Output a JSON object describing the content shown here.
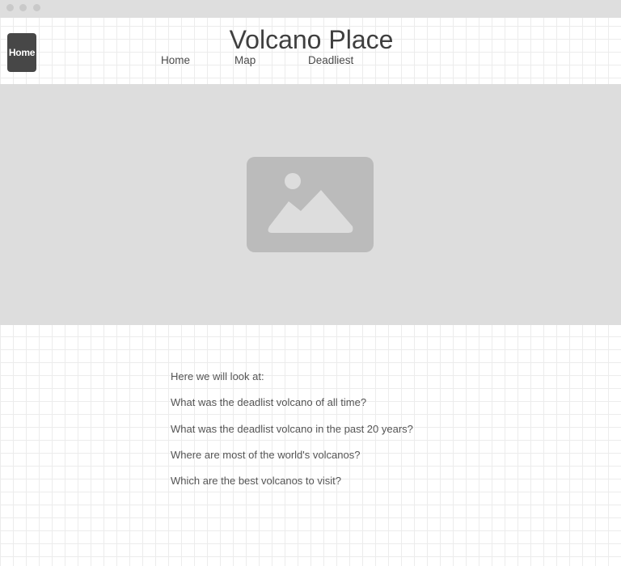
{
  "site": {
    "title": "Volcano Place",
    "home_badge": "Home"
  },
  "nav": {
    "items": [
      {
        "label": "Home"
      },
      {
        "label": "Map"
      },
      {
        "label": "Deadliest"
      }
    ]
  },
  "hero": {
    "icon": "image-placeholder-icon"
  },
  "content": {
    "intro": "Here we will look at:",
    "questions": [
      "What was the deadlist volcano of all time?",
      "What was the deadlist volcano in the past 20 years?",
      "Where are most of the world's volcanos?",
      "Which are the best volcanos to visit?"
    ]
  },
  "colors": {
    "badge_bg": "#474747",
    "hero_bg": "#dddddd",
    "placeholder": "#bbbbbb",
    "text": "#555555"
  }
}
